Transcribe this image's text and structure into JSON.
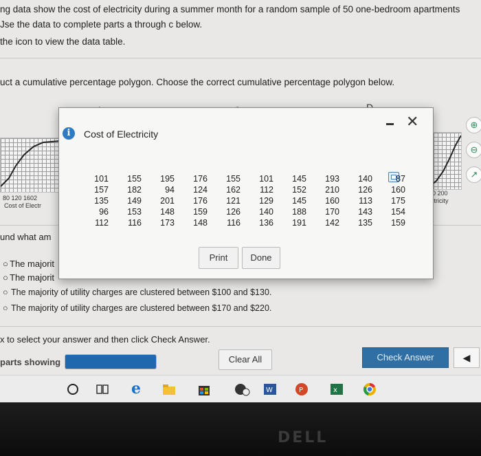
{
  "question": {
    "line1": "ng data show the cost of electricity during a summer month for a random sample of 50 one-bedroom apartments",
    "line2": "Jse the data to complete parts a through c below.",
    "line3": "the icon to view the data table.",
    "instruction": "uct a cumulative percentage polygon. Choose the correct cumulative percentage polygon below."
  },
  "choices": {
    "a_label": "A.",
    "b_label": "B.",
    "c_label": "C.",
    "d_label": "D.",
    "left_chart_ticks": "80 120 1602",
    "left_chart_caption": "Cost of Electr",
    "right_chart_ticks": "50 200",
    "right_chart_caption": "ectricity"
  },
  "part_b": {
    "question": "und what am",
    "option_a": "The majorit",
    "option_b": "The majorit",
    "option_c": "The majority of utility charges are clustered between $100 and $130.",
    "option_d": "The majority of utility charges are clustered between $170 and $220."
  },
  "modal": {
    "title": "Cost of Electricity",
    "print_label": "Print",
    "done_label": "Done",
    "minimize_symbol": "-",
    "close_symbol": "✕",
    "table": [
      [
        "101",
        "155",
        "195",
        "176",
        "155",
        "101",
        "145",
        "193",
        "140",
        "87"
      ],
      [
        "157",
        "182",
        "94",
        "124",
        "162",
        "112",
        "152",
        "210",
        "126",
        "160"
      ],
      [
        "135",
        "149",
        "201",
        "176",
        "121",
        "129",
        "145",
        "160",
        "113",
        "175"
      ],
      [
        "96",
        "153",
        "148",
        "159",
        "126",
        "140",
        "188",
        "170",
        "143",
        "154"
      ],
      [
        "112",
        "116",
        "173",
        "148",
        "116",
        "136",
        "191",
        "142",
        "135",
        "159"
      ]
    ]
  },
  "footer": {
    "instruction": "x to select your answer and then click Check Answer.",
    "parts_label": "parts showing",
    "progress": 1.0,
    "clear_all": "Clear All",
    "check_answer": "Check Answer",
    "next_arrow": "◀"
  },
  "bezel": {
    "brand": "DELL"
  },
  "colors": {
    "accent_blue": "#1f68ad",
    "check_button": "#2f6fa3",
    "info_icon": "#2e7bc4"
  },
  "icons": {
    "side": [
      "zoom-in-icon",
      "zoom-out-icon",
      "popout-icon"
    ],
    "taskbar": [
      "cortana-icon",
      "task-view-icon",
      "edge-icon",
      "file-explorer-icon",
      "store-icon",
      "media-icon",
      "word-icon",
      "powerpoint-icon",
      "excel-icon",
      "chrome-icon"
    ]
  }
}
